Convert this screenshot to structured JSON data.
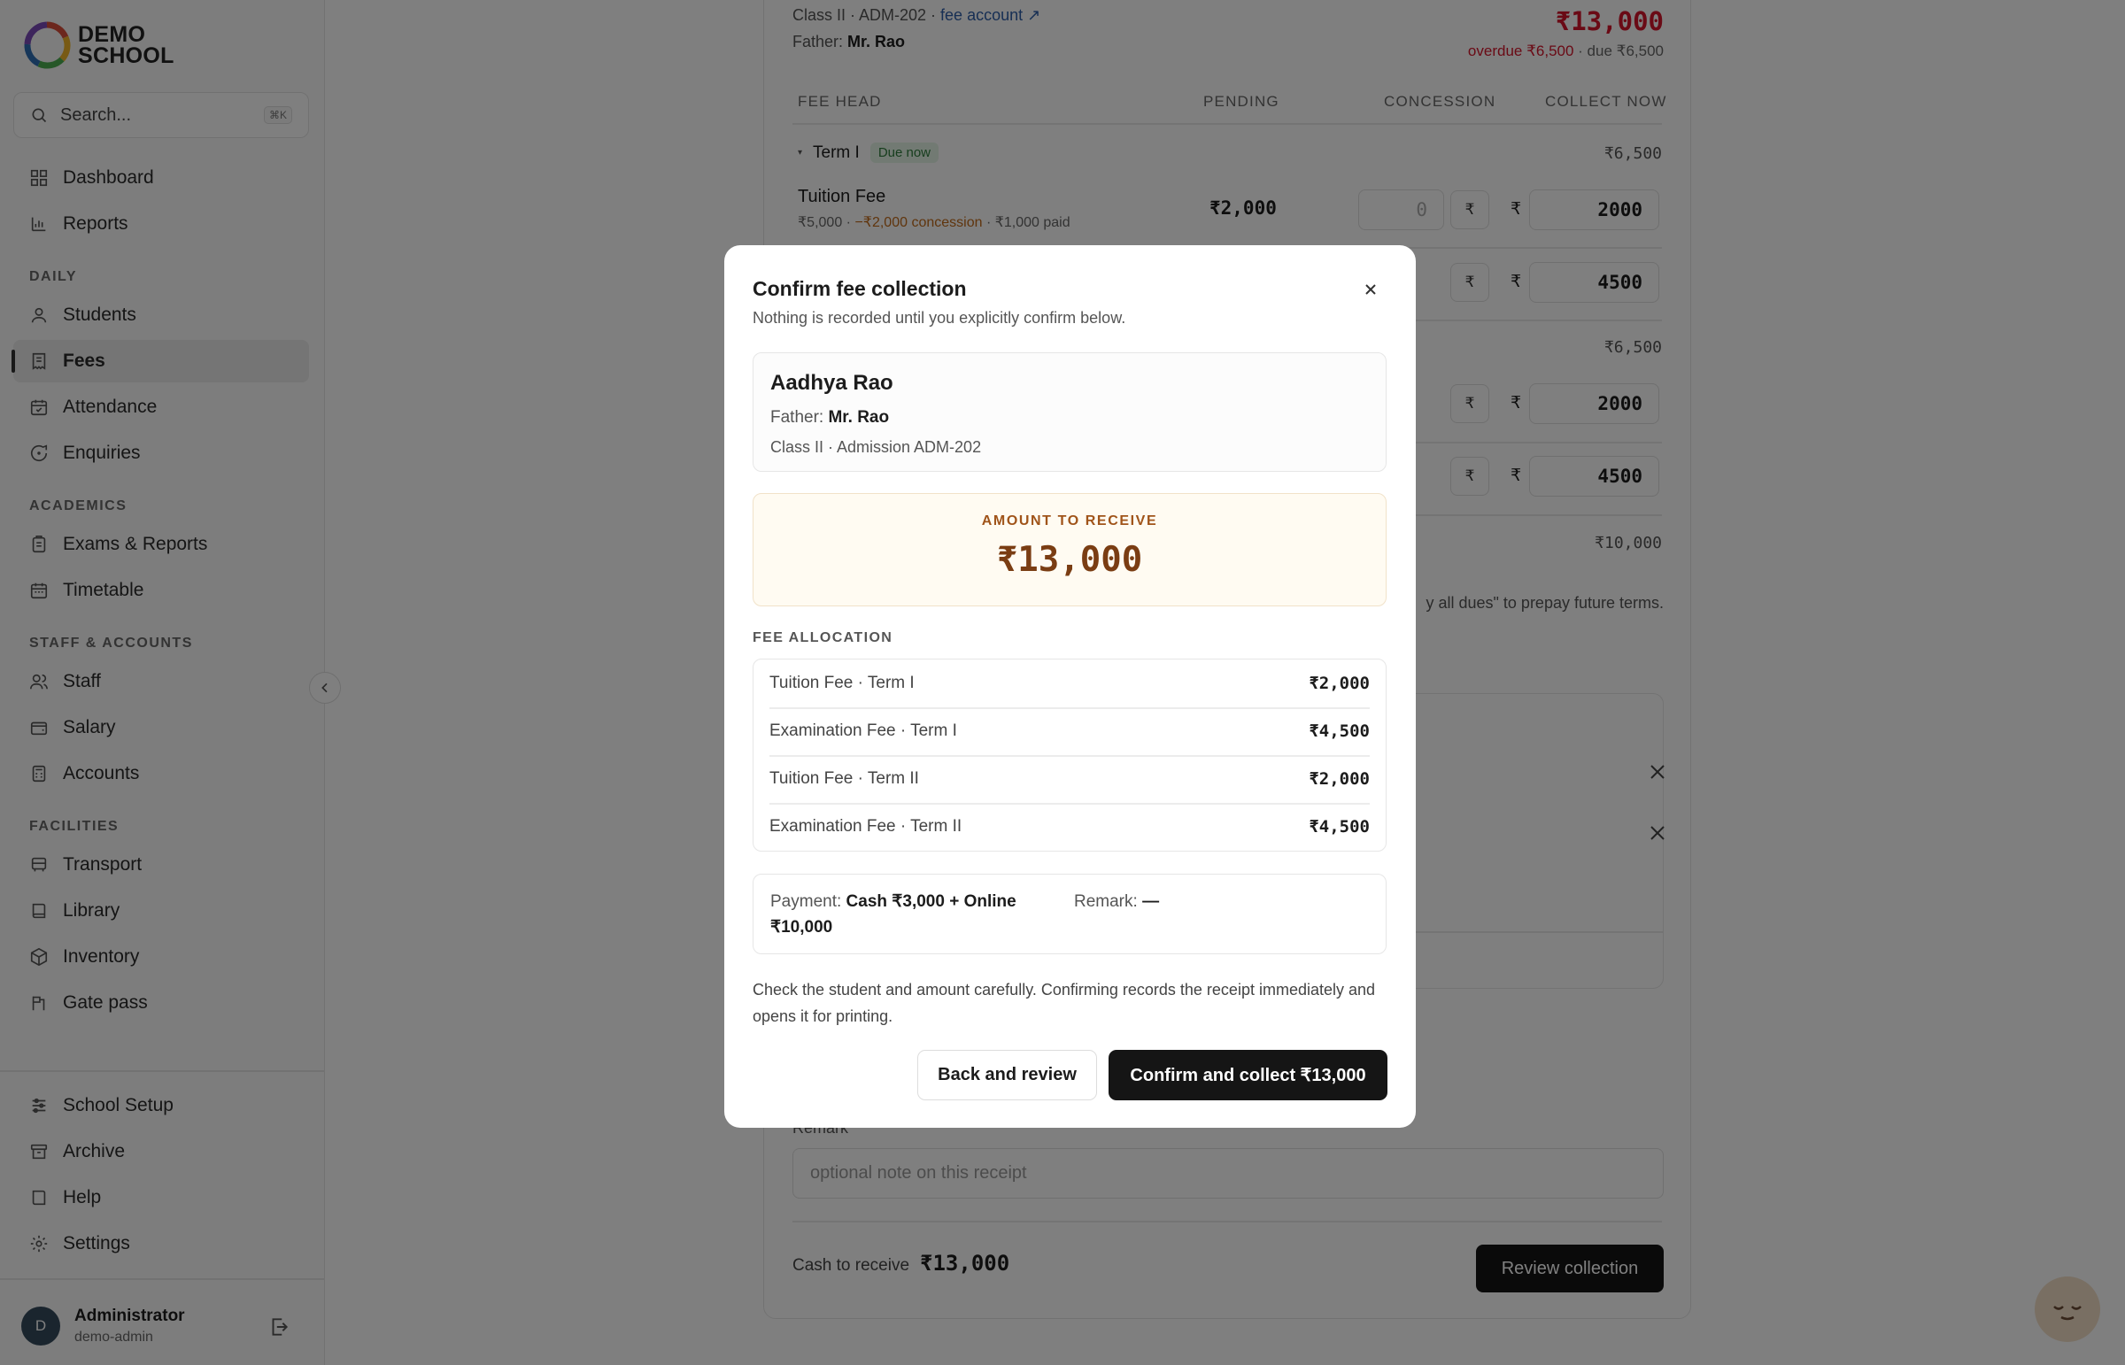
{
  "brand": {
    "line1": "DEMO",
    "line2": "SCHOOL"
  },
  "search": {
    "placeholder": "Search...",
    "shortcut": "⌘K"
  },
  "nav": {
    "top": [
      {
        "label": "Dashboard"
      },
      {
        "label": "Reports"
      }
    ],
    "daily_label": "DAILY",
    "daily": [
      {
        "label": "Students"
      },
      {
        "label": "Fees"
      },
      {
        "label": "Attendance"
      },
      {
        "label": "Enquiries"
      }
    ],
    "academics_label": "ACADEMICS",
    "academics": [
      {
        "label": "Exams & Reports"
      },
      {
        "label": "Timetable"
      }
    ],
    "staff_label": "STAFF & ACCOUNTS",
    "staff": [
      {
        "label": "Staff"
      },
      {
        "label": "Salary"
      },
      {
        "label": "Accounts"
      }
    ],
    "facilities_label": "FACILITIES",
    "facilities": [
      {
        "label": "Transport"
      },
      {
        "label": "Library"
      },
      {
        "label": "Inventory"
      },
      {
        "label": "Gate pass"
      }
    ],
    "bottom": [
      {
        "label": "School Setup"
      },
      {
        "label": "Archive"
      },
      {
        "label": "Help"
      },
      {
        "label": "Settings"
      }
    ]
  },
  "user": {
    "initial": "D",
    "name": "Administrator",
    "username": "demo-admin"
  },
  "main": {
    "student_meta": "Class II · ADM-202 · ",
    "fee_account_link": "fee account ↗",
    "father_label": "Father: ",
    "father_name": "Mr. Rao",
    "total": "₹13,000",
    "overdue": "overdue ₹6,500",
    "due": " · due ₹6,500",
    "columns": [
      "FEE HEAD",
      "PENDING",
      "CONCESSION",
      "COLLECT NOW"
    ],
    "term1": {
      "label": "Term I",
      "badge": "Due now",
      "total": "₹6,500"
    },
    "tuition": {
      "name": "Tuition Fee",
      "sub_base": "₹5,000 · ",
      "sub_concession": "−₹2,000 concession",
      "sub_paid": " · ₹1,000 paid",
      "pending": "₹2,000",
      "concession_placeholder": "0",
      "collect": "2000"
    },
    "row2_collect": "4500",
    "term2_total": "₹6,500",
    "row3_collect": "2000",
    "row4_collect": "4500",
    "future_total": "₹10,000",
    "prepay_note": "y all dues\" to prepay future terms.",
    "remark_label": "Remark",
    "remark_placeholder": "optional note on this receipt",
    "cash_label": "Cash to receive",
    "cash_value": "₹13,000",
    "review_button": "Review collection",
    "rupee": "₹"
  },
  "modal": {
    "title": "Confirm fee collection",
    "subtitle": "Nothing is recorded until you explicitly confirm below.",
    "student_name": "Aadhya Rao",
    "father_label": "Father: ",
    "father_name": "Mr. Rao",
    "class_line": "Class II · Admission ADM-202",
    "amount_label": "AMOUNT TO RECEIVE",
    "amount": "₹13,000",
    "allocation_label": "FEE ALLOCATION",
    "allocation": [
      {
        "name": "Tuition Fee · Term I",
        "amount": "₹2,000"
      },
      {
        "name": "Examination Fee · Term I",
        "amount": "₹4,500"
      },
      {
        "name": "Tuition Fee · Term II",
        "amount": "₹2,000"
      },
      {
        "name": "Examination Fee · Term II",
        "amount": "₹4,500"
      }
    ],
    "payment_label": "Payment: ",
    "payment_value": "Cash ₹3,000 + Online ₹10,000",
    "remark_label": "Remark: ",
    "remark_value": "—",
    "note": "Check the student and amount carefully. Confirming records the receipt immediately and opens it for printing.",
    "back_button": "Back and review",
    "confirm_button": "Confirm and collect ₹13,000"
  }
}
